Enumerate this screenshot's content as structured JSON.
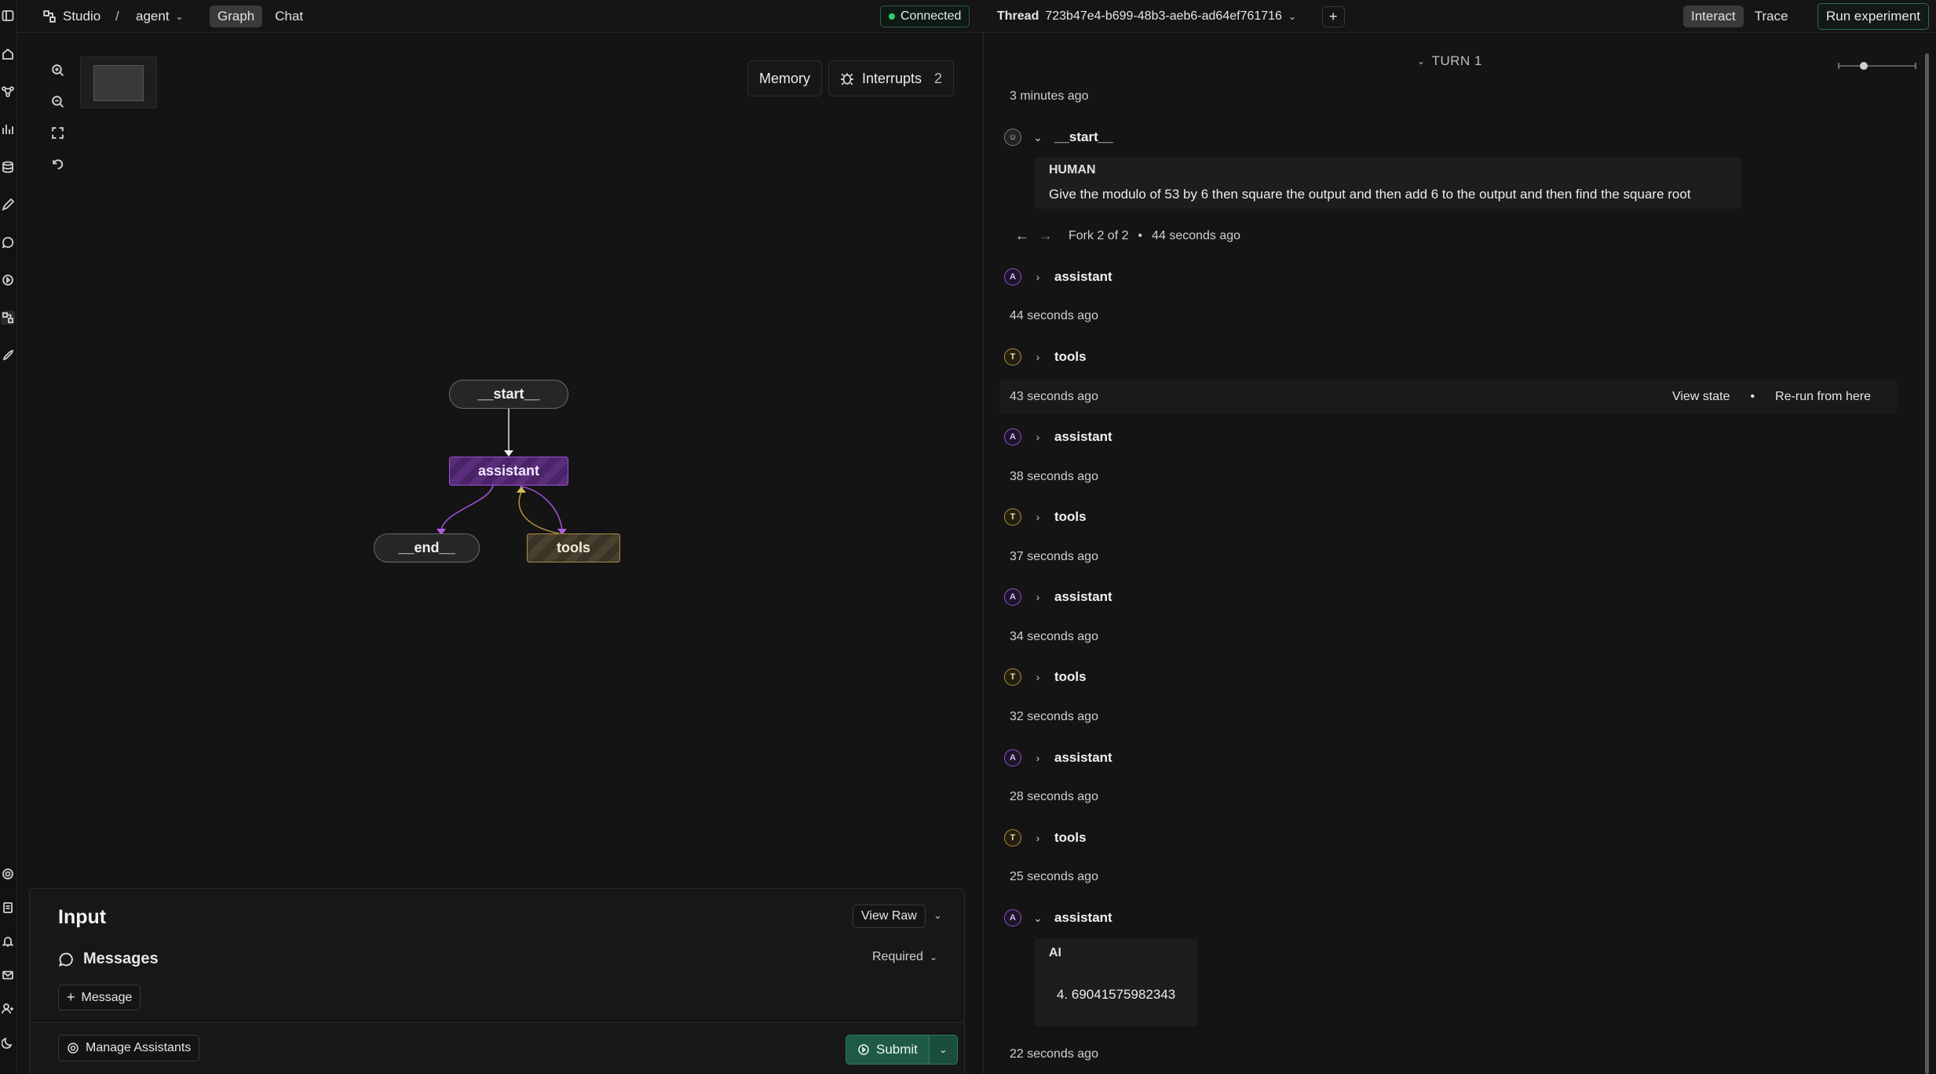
{
  "topbar": {
    "breadcrumb": {
      "studio": "Studio",
      "separator": "/",
      "agent": "agent"
    },
    "view_tabs": [
      {
        "label": "Graph",
        "active": true
      },
      {
        "label": "Chat",
        "active": false
      }
    ],
    "status": "Connected",
    "thread_label": "Thread",
    "thread_id": "723b47e4-b699-48b3-aeb6-ad64ef761716",
    "mode_tabs": [
      {
        "label": "Interact",
        "active": true
      },
      {
        "label": "Trace",
        "active": false
      }
    ],
    "run_experiment": "Run experiment"
  },
  "graph": {
    "memory_btn": "Memory",
    "interrupts_btn": "Interrupts",
    "interrupts_count": "2",
    "nodes": {
      "start": "__start__",
      "assistant": "assistant",
      "end": "__end__",
      "tools": "tools"
    }
  },
  "input": {
    "title": "Input",
    "view_raw": "View Raw",
    "messages_label": "Messages",
    "required": "Required",
    "add_message": "Message",
    "manage_assistants": "Manage Assistants",
    "submit": "Submit"
  },
  "thread": {
    "turn": "TURN 1",
    "start_ts": "3 minutes ago",
    "start_step": "__start__",
    "human_role": "HUMAN",
    "human_text": "Give the modulo of 53 by 6 then square the output and then add 6 to the output and then find the square root",
    "fork": {
      "label": "Fork 2 of 2",
      "bullet": "•",
      "time": "44 seconds ago"
    },
    "hover_actions": {
      "view_state": "View state",
      "bullet": "•",
      "rerun": "Re-run from here"
    },
    "steps": [
      {
        "avatar": "A",
        "label": "assistant",
        "ts": "44 seconds ago"
      },
      {
        "avatar": "T",
        "label": "tools",
        "ts": "43 seconds ago"
      },
      {
        "avatar": "A",
        "label": "assistant",
        "ts": "38 seconds ago"
      },
      {
        "avatar": "T",
        "label": "tools",
        "ts": "37 seconds ago"
      },
      {
        "avatar": "A",
        "label": "assistant",
        "ts": "34 seconds ago"
      },
      {
        "avatar": "T",
        "label": "tools",
        "ts": "32 seconds ago"
      },
      {
        "avatar": "A",
        "label": "assistant",
        "ts": "28 seconds ago"
      },
      {
        "avatar": "T",
        "label": "tools",
        "ts": "25 seconds ago"
      },
      {
        "avatar": "A",
        "label": "assistant",
        "ts": ""
      }
    ],
    "ai_role": "AI",
    "ai_text": "4. 69041575982343",
    "final_ts": "22 seconds ago"
  },
  "colors": {
    "assistant": "#8e4fd1",
    "tools": "#b08d3d",
    "connected": "#2ecc71",
    "submit": "#1f5a48"
  }
}
